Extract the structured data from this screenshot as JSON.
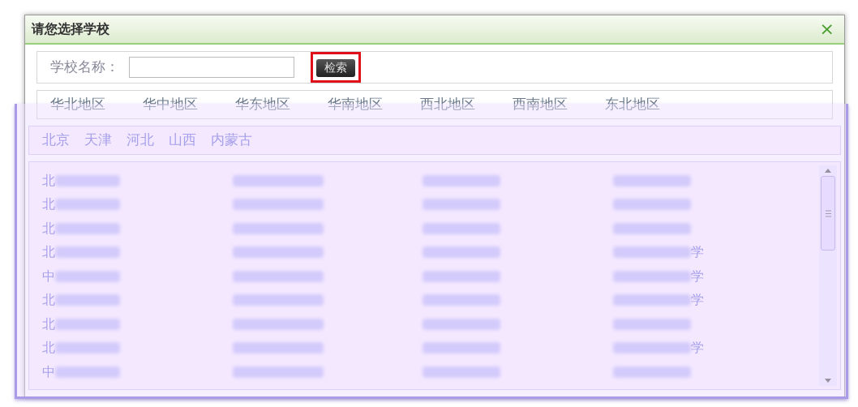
{
  "dialog": {
    "title": "请您选择学校",
    "close": "×"
  },
  "search": {
    "label": "学校名称：",
    "button": "检索",
    "highlighted": true
  },
  "regions": [
    {
      "label": "华北地区"
    },
    {
      "label": "华中地区"
    },
    {
      "label": "华东地区"
    },
    {
      "label": "华南地区"
    },
    {
      "label": "西北地区"
    },
    {
      "label": "西南地区"
    },
    {
      "label": "东北地区"
    }
  ],
  "provinces": [
    {
      "label": "北京"
    },
    {
      "label": "天津"
    },
    {
      "label": "河北"
    },
    {
      "label": "山西"
    },
    {
      "label": "内蒙古"
    }
  ],
  "schools": [
    [
      {
        "kind": "head",
        "text": "北"
      },
      {
        "kind": "hidden"
      },
      {
        "kind": "hidden"
      },
      {
        "kind": "hidden"
      }
    ],
    [
      {
        "kind": "head",
        "text": "北"
      },
      {
        "kind": "hidden"
      },
      {
        "kind": "hidden"
      },
      {
        "kind": "hidden"
      }
    ],
    [
      {
        "kind": "head",
        "text": "北"
      },
      {
        "kind": "hidden"
      },
      {
        "kind": "hidden"
      },
      {
        "kind": "hidden"
      }
    ],
    [
      {
        "kind": "head",
        "text": "北"
      },
      {
        "kind": "hidden"
      },
      {
        "kind": "hidden"
      },
      {
        "kind": "tail",
        "text": "学"
      }
    ],
    [
      {
        "kind": "head",
        "text": "中"
      },
      {
        "kind": "hidden"
      },
      {
        "kind": "hidden"
      },
      {
        "kind": "tail",
        "text": "学"
      }
    ],
    [
      {
        "kind": "head",
        "text": "北"
      },
      {
        "kind": "hidden"
      },
      {
        "kind": "hidden"
      },
      {
        "kind": "tail",
        "text": "学"
      }
    ],
    [
      {
        "kind": "head",
        "text": "北"
      },
      {
        "kind": "hidden"
      },
      {
        "kind": "hidden"
      },
      {
        "kind": "hidden"
      }
    ],
    [
      {
        "kind": "head",
        "text": "北"
      },
      {
        "kind": "hidden"
      },
      {
        "kind": "hidden"
      },
      {
        "kind": "tail",
        "text": "学"
      }
    ],
    [
      {
        "kind": "head",
        "text": "中"
      },
      {
        "kind": "hidden"
      },
      {
        "kind": "hidden"
      },
      {
        "kind": "hidden"
      }
    ]
  ]
}
